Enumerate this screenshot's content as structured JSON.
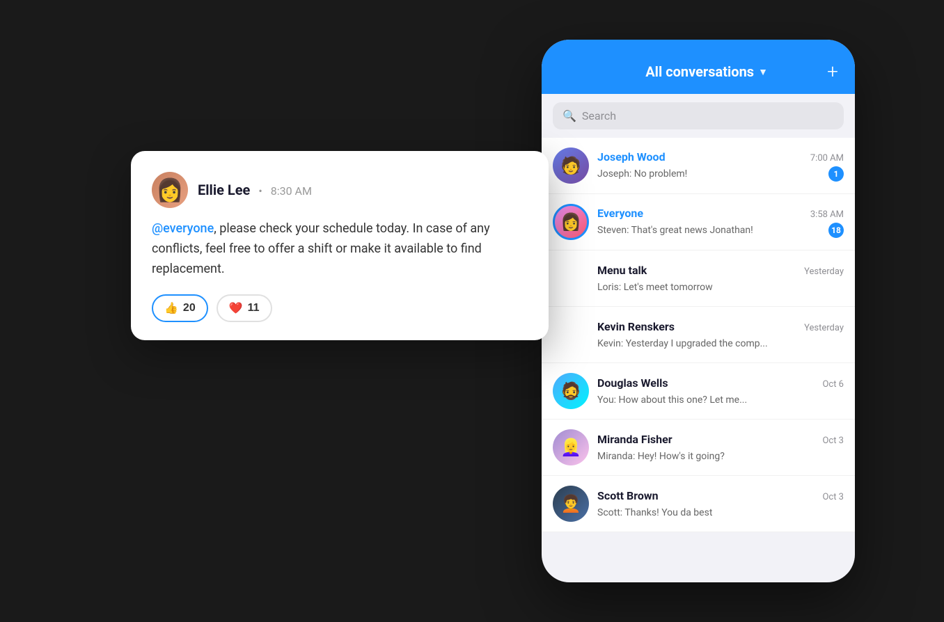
{
  "app": {
    "title": "All conversations",
    "header": {
      "title": "All conversations",
      "chevron": "▼",
      "plus": "+"
    },
    "search": {
      "placeholder": "Search"
    },
    "conversations": [
      {
        "id": "joseph-wood",
        "name": "Joseph Wood",
        "preview": "Joseph: No problem!",
        "time": "7:00 AM",
        "badge": "1",
        "avatar_class": "joseph",
        "name_class": "blue"
      },
      {
        "id": "everyone",
        "name": "Everyone",
        "preview": "Steven: That's great news Jonathan!",
        "time": "3:58 AM",
        "badge": "18",
        "avatar_class": "everyone",
        "name_class": "blue"
      },
      {
        "id": "menu-talk",
        "name": "Menu talk",
        "preview": "Loris: Let's meet tomorrow",
        "time": "Yesterday",
        "badge": "",
        "avatar_class": "no-avatar",
        "name_class": ""
      },
      {
        "id": "kevin-renskers",
        "name": "Kevin Renskers",
        "preview": "Kevin: Yesterday I upgraded the comp...",
        "time": "Yesterday",
        "badge": "",
        "avatar_class": "no-avatar",
        "name_class": ""
      },
      {
        "id": "douglas-wells",
        "name": "Douglas Wells",
        "preview": "You: How about this one? Let me...",
        "time": "Oct 6",
        "badge": "",
        "avatar_class": "douglas",
        "name_class": ""
      },
      {
        "id": "miranda-fisher",
        "name": "Miranda Fisher",
        "preview": "Miranda: Hey! How's it going?",
        "time": "Oct 3",
        "badge": "",
        "avatar_class": "miranda",
        "name_class": ""
      },
      {
        "id": "scott-brown",
        "name": "Scott Brown",
        "preview": "Scott: Thanks! You da best",
        "time": "Oct 3",
        "badge": "",
        "avatar_class": "scott",
        "name_class": ""
      }
    ]
  },
  "message_card": {
    "sender": "Ellie Lee",
    "time": "8:30 AM",
    "mention": "@everyone",
    "body_before": ", please check your schedule today. In case of any conflicts, feel free to offer a shift or make it available to find replacement.",
    "reaction_thumbs_emoji": "👍",
    "reaction_thumbs_count": "20",
    "reaction_heart_emoji": "❤️",
    "reaction_heart_count": "11"
  }
}
